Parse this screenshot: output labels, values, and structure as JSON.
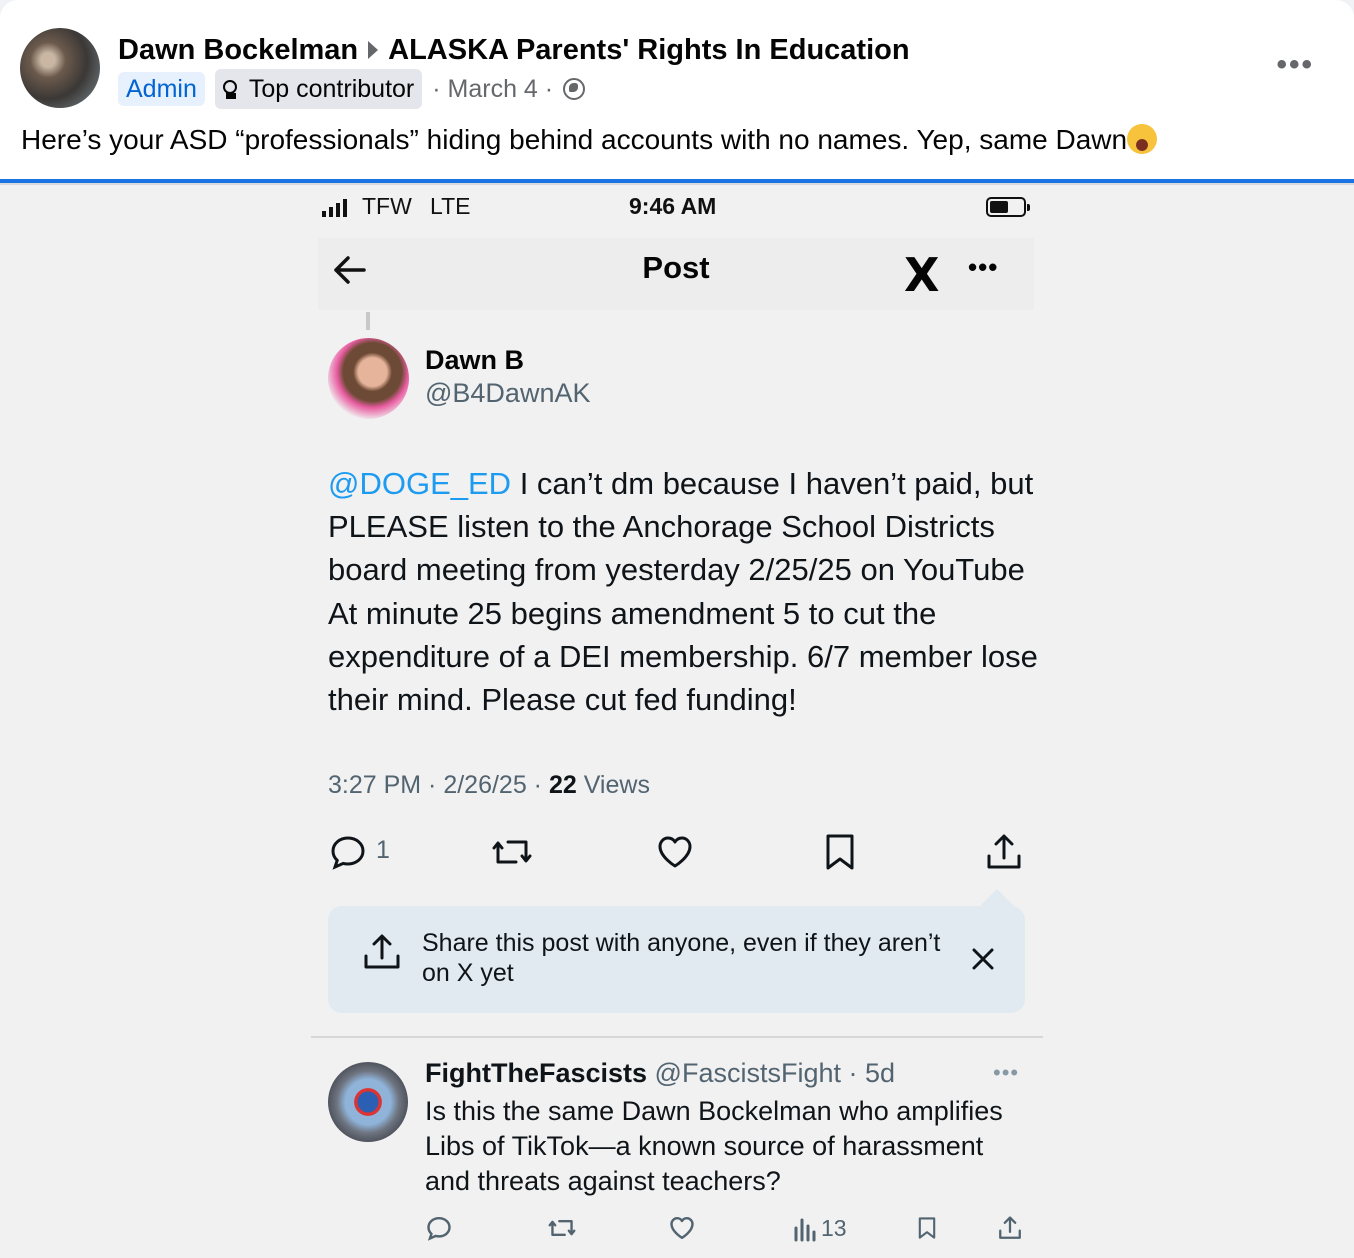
{
  "post": {
    "author": "Dawn Bockelman",
    "group": "ALASKA Parents' Rights In Education",
    "badge_admin": "Admin",
    "badge_top": "Top contributor",
    "date": "· March 4 ·",
    "text": "Here’s your ASD “professionals” hiding behind accounts with no names. Yep, same Dawn",
    "more": "•••"
  },
  "screenshot": {
    "status": {
      "carrier": "TFW",
      "network": "LTE",
      "time": "9:46 AM"
    },
    "header": {
      "title": "Post",
      "logo": "X",
      "more": "•••"
    },
    "tweet": {
      "name": "Dawn B",
      "handle": "@B4DawnAK",
      "mention": "@DOGE_ED",
      "body": " I can’t dm because I haven’t paid, but PLEASE listen to the Anchorage School Districts board meeting from yesterday 2/25/25 on YouTube At minute 25 begins amendment 5 to cut the expenditure of a DEI membership. 6/7 member lose their mind. Please cut fed funding!",
      "time_date": "3:27 PM · 2/26/25 · ",
      "views_count": "22",
      "views_label": " Views",
      "reply_count": "1"
    },
    "share_prompt": {
      "text": "Share this post with anyone, even if they aren’t on X yet"
    },
    "reply": {
      "name": "FightTheFascists",
      "handle": " @FascistsFight · 5d",
      "more": "•••",
      "text": "Is this the same Dawn Bockelman who amplifies Libs of TikTok—a known source of harassment and threats against teachers?",
      "views_count": "13"
    }
  },
  "colors": {
    "facebook_blue": "#1b74e4",
    "x_link_blue": "#1d9bf0",
    "secondary_text": "#536471"
  },
  "icons": [
    "globe-icon",
    "medal-icon",
    "back-arrow-icon",
    "x-logo",
    "reply-icon",
    "repost-icon",
    "like-icon",
    "bookmark-icon",
    "share-icon",
    "close-icon",
    "views-icon"
  ]
}
